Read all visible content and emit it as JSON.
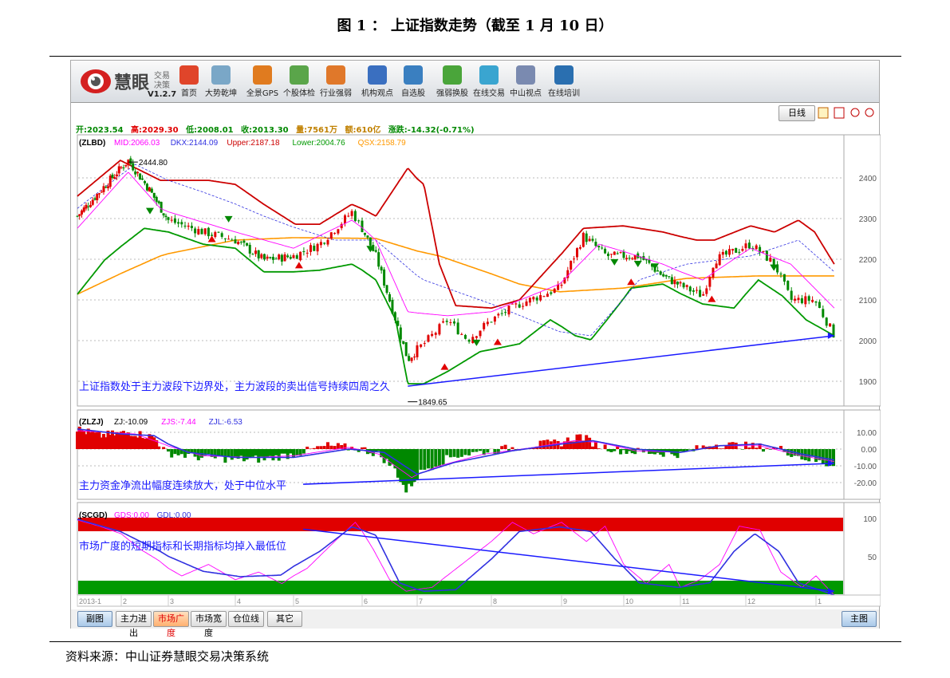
{
  "title": "图 1 ： 上证指数走势（截至 1 月 10 日）",
  "source": "资料来源：中山证券慧眼交易决策系统",
  "app": {
    "logo_name": "慧眼",
    "logo_sub1": "交易",
    "logo_sub2": "决策",
    "version": "V1.2.7",
    "toolbar": [
      {
        "label": "首页",
        "icon": "home-icon",
        "color": "#e0452a"
      },
      {
        "label": "大势乾坤",
        "icon": "magnifier-doc-icon",
        "color": "#7aa7c7"
      },
      {
        "label": "全景GPS",
        "icon": "grid-icon",
        "color": "#e07b1f"
      },
      {
        "label": "个股体检",
        "icon": "checkup-icon",
        "color": "#5aa54a"
      },
      {
        "label": "行业强弱",
        "icon": "bar-chart-icon",
        "color": "#e0782a"
      },
      {
        "label": "机构观点",
        "icon": "person-icon",
        "color": "#3a6fc0"
      },
      {
        "label": "自选股",
        "icon": "briefcase-icon",
        "color": "#3a7fc0"
      },
      {
        "label": "强弱换股",
        "icon": "refresh-icon",
        "color": "#4aa53a"
      },
      {
        "label": "在线交易",
        "icon": "cart-icon",
        "color": "#3aa5d0"
      },
      {
        "label": "中山视点",
        "icon": "document-icon",
        "color": "#7a8ab0"
      },
      {
        "label": "在线培训",
        "icon": "monitor-icon",
        "color": "#2a6fb0"
      }
    ],
    "period_button": "日线",
    "info": {
      "open": "开:2023.54",
      "high": "高:2029.30",
      "low": "低:2008.01",
      "close": "收:2013.30",
      "volume": "量:7561万",
      "amount": "额:610亿",
      "change": "涨跌:-14.32(-0.71%)"
    },
    "bottom_buttons": [
      "副图",
      "主力进出",
      "市场广度",
      "市场宽度",
      "仓位线",
      "其它"
    ],
    "active_bottom": "市场广度",
    "main_button": "主图"
  },
  "colors": {
    "up": "#e00000",
    "down": "#008800",
    "mid": "#ff00ff",
    "dkx": "#3030e0",
    "upper": "#cc0000",
    "lower": "#009900",
    "qsx": "#ff9900",
    "annotation": "#1a1aff"
  },
  "chart_data": [
    {
      "type": "candlestick",
      "name_label": "(ZLBD)",
      "legend": [
        {
          "label": "MID:2066.03",
          "key": "mid"
        },
        {
          "label": "DKX:2144.09",
          "key": "dkx"
        },
        {
          "label": "Upper:2187.18",
          "key": "upper"
        },
        {
          "label": "Lower:2004.76",
          "key": "lower"
        },
        {
          "label": "QSX:2158.79",
          "key": "qsx"
        }
      ],
      "ylim": [
        1850,
        2500
      ],
      "yticks": [
        "2400",
        "2300",
        "2200",
        "2100",
        "2000",
        "1900"
      ],
      "ytick_values": [
        2400,
        2300,
        2200,
        2100,
        2000,
        1900
      ],
      "x_unit": "month (1 = 2013-1, 13 = 2014-1)",
      "close": [
        [
          1.0,
          2306
        ],
        [
          2.15,
          2443
        ],
        [
          2.58,
          2374
        ],
        [
          3.0,
          2296
        ],
        [
          3.52,
          2267
        ],
        [
          4.0,
          2247
        ],
        [
          4.49,
          2198
        ],
        [
          5.0,
          2208
        ],
        [
          5.38,
          2237
        ],
        [
          5.85,
          2316
        ],
        [
          6.25,
          2208
        ],
        [
          6.61,
          2051
        ],
        [
          6.83,
          1953
        ],
        [
          7.09,
          1992
        ],
        [
          7.41,
          2051
        ],
        [
          7.68,
          2002
        ],
        [
          8.0,
          2051
        ],
        [
          8.4,
          2090
        ],
        [
          8.97,
          2129
        ],
        [
          9.35,
          2257
        ],
        [
          9.73,
          2208
        ],
        [
          10.27,
          2208
        ],
        [
          10.69,
          2159
        ],
        [
          11.34,
          2110
        ],
        [
          11.52,
          2198
        ],
        [
          12.07,
          2237
        ],
        [
          12.41,
          2188
        ],
        [
          12.64,
          2100
        ],
        [
          12.98,
          2100
        ],
        [
          13.26,
          2013
        ]
      ],
      "upper": [
        [
          1.0,
          2355
        ],
        [
          1.98,
          2443
        ],
        [
          2.83,
          2394
        ],
        [
          3.6,
          2394
        ],
        [
          4.0,
          2384
        ],
        [
          4.49,
          2335
        ],
        [
          5.03,
          2286
        ],
        [
          5.38,
          2286
        ],
        [
          5.85,
          2335
        ],
        [
          6.25,
          2306
        ],
        [
          6.83,
          2424
        ],
        [
          7.09,
          2384
        ],
        [
          7.3,
          2188
        ],
        [
          7.52,
          2086
        ],
        [
          8.0,
          2080
        ],
        [
          8.4,
          2100
        ],
        [
          8.97,
          2208
        ],
        [
          9.35,
          2276
        ],
        [
          9.99,
          2282
        ],
        [
          10.69,
          2267
        ],
        [
          11.25,
          2247
        ],
        [
          11.52,
          2247
        ],
        [
          12.07,
          2282
        ],
        [
          12.41,
          2267
        ],
        [
          12.75,
          2296
        ],
        [
          12.98,
          2267
        ],
        [
          13.26,
          2188
        ]
      ],
      "lower": [
        [
          1.0,
          2114
        ],
        [
          1.62,
          2198
        ],
        [
          2.49,
          2276
        ],
        [
          3.0,
          2267
        ],
        [
          3.52,
          2237
        ],
        [
          4.0,
          2227
        ],
        [
          4.49,
          2169
        ],
        [
          5.0,
          2169
        ],
        [
          5.38,
          2173
        ],
        [
          5.85,
          2188
        ],
        [
          6.25,
          2149
        ],
        [
          6.61,
          2051
        ],
        [
          6.83,
          1894
        ],
        [
          7.09,
          1894
        ],
        [
          7.41,
          1924
        ],
        [
          7.85,
          1973
        ],
        [
          8.4,
          1992
        ],
        [
          8.84,
          2051
        ],
        [
          9.22,
          2012
        ],
        [
          9.47,
          2002
        ],
        [
          9.73,
          2051
        ],
        [
          10.13,
          2129
        ],
        [
          10.69,
          2139
        ],
        [
          11.34,
          2090
        ],
        [
          11.82,
          2080
        ],
        [
          12.18,
          2149
        ],
        [
          12.52,
          2110
        ],
        [
          12.86,
          2051
        ],
        [
          13.26,
          2012
        ]
      ],
      "qsx": [
        [
          1.0,
          2114
        ],
        [
          2.83,
          2208
        ],
        [
          4.0,
          2247
        ],
        [
          5.0,
          2253
        ],
        [
          6.25,
          2251
        ],
        [
          7.3,
          2208
        ],
        [
          8.4,
          2139
        ],
        [
          8.97,
          2120
        ],
        [
          9.99,
          2129
        ],
        [
          11.1,
          2153
        ],
        [
          12.18,
          2159
        ],
        [
          13.26,
          2159
        ]
      ],
      "mid": [
        [
          1.0,
          2276
        ],
        [
          2.15,
          2414
        ],
        [
          2.83,
          2325
        ],
        [
          4.0,
          2267
        ],
        [
          5.0,
          2227
        ],
        [
          5.85,
          2296
        ],
        [
          6.25,
          2247
        ],
        [
          6.83,
          2071
        ],
        [
          7.41,
          2061
        ],
        [
          8.0,
          2071
        ],
        [
          8.97,
          2139
        ],
        [
          9.6,
          2237
        ],
        [
          10.69,
          2188
        ],
        [
          11.34,
          2149
        ],
        [
          12.07,
          2227
        ],
        [
          12.64,
          2188
        ],
        [
          13.26,
          2080
        ]
      ],
      "dkx": [
        [
          1.0,
          2325
        ],
        [
          2.3,
          2433
        ],
        [
          3.52,
          2365
        ],
        [
          4.49,
          2306
        ],
        [
          5.6,
          2247
        ],
        [
          6.25,
          2247
        ],
        [
          7.09,
          2149
        ],
        [
          8.0,
          2090
        ],
        [
          8.97,
          2022
        ],
        [
          9.47,
          2012
        ],
        [
          10.27,
          2149
        ],
        [
          11.1,
          2188
        ],
        [
          12.07,
          2208
        ],
        [
          12.75,
          2247
        ],
        [
          13.26,
          2169
        ]
      ],
      "sell_signals": [
        2.61,
        3.9,
        6.15,
        7.8,
        9.85,
        10.25,
        10.55,
        12.4
      ],
      "buy_signals": [
        3.65,
        5.08,
        7.37,
        8.09,
        10.13,
        11.48
      ],
      "annotations": [
        {
          "text": "2444.80",
          "x": 2.15,
          "y": 2444.8
        },
        {
          "text": "1849.65",
          "x": 6.83,
          "y": 1849.65
        }
      ],
      "trendline": [
        [
          6.83,
          1888
        ],
        [
          13.26,
          2012
        ]
      ],
      "comment": "上证指数处于主力波段下边界处，主力波段的卖出信号持续四周之久"
    },
    {
      "type": "bar",
      "name_label": "(ZLZJ)",
      "legend": [
        {
          "label": "ZJ:-10.09",
          "key": "zj"
        },
        {
          "label": "ZJS:-7.44",
          "key": "zjs"
        },
        {
          "label": "ZJL:-6.53",
          "key": "zjl"
        }
      ],
      "ylim": [
        -30,
        14
      ],
      "yticks": [
        "10.00",
        "0.00",
        "-10.00",
        "-20.00"
      ],
      "ytick_values": [
        10,
        0,
        -10,
        -20
      ],
      "zj": [
        [
          1.0,
          12
        ],
        [
          1.5,
          8
        ],
        [
          2.2,
          10
        ],
        [
          2.7,
          7
        ],
        [
          2.95,
          -2
        ],
        [
          3.5,
          -5
        ],
        [
          4.0,
          -6
        ],
        [
          4.5,
          -6
        ],
        [
          5.0,
          -3
        ],
        [
          5.5,
          2
        ],
        [
          6.0,
          0
        ],
        [
          6.3,
          -3
        ],
        [
          6.6,
          -12
        ],
        [
          6.8,
          -25
        ],
        [
          7.1,
          -12
        ],
        [
          7.5,
          -4
        ],
        [
          8.0,
          -1
        ],
        [
          8.5,
          2
        ],
        [
          9.0,
          4
        ],
        [
          9.3,
          8
        ],
        [
          9.6,
          2
        ],
        [
          10.0,
          -1
        ],
        [
          10.5,
          -2
        ],
        [
          11.0,
          -3
        ],
        [
          11.5,
          3
        ],
        [
          12.0,
          2
        ],
        [
          12.5,
          0
        ],
        [
          12.8,
          -5
        ],
        [
          13.26,
          -10.09
        ]
      ],
      "zjs": [
        [
          1.0,
          11
        ],
        [
          2.3,
          9
        ],
        [
          2.9,
          3
        ],
        [
          3.5,
          -4
        ],
        [
          4.3,
          -5
        ],
        [
          5.0,
          -4
        ],
        [
          5.8,
          1
        ],
        [
          6.3,
          -3
        ],
        [
          6.9,
          -17
        ],
        [
          7.3,
          -10
        ],
        [
          7.9,
          -3
        ],
        [
          8.6,
          1
        ],
        [
          9.2,
          5
        ],
        [
          9.6,
          4
        ],
        [
          10.2,
          -1
        ],
        [
          11.0,
          -2
        ],
        [
          11.6,
          2
        ],
        [
          12.2,
          2
        ],
        [
          12.8,
          -4
        ],
        [
          13.26,
          -7.44
        ]
      ],
      "zjl": [
        [
          1.0,
          12
        ],
        [
          2.0,
          9
        ],
        [
          2.7,
          8
        ],
        [
          3.3,
          -2
        ],
        [
          4.0,
          -5
        ],
        [
          5.0,
          -5
        ],
        [
          5.8,
          0
        ],
        [
          6.4,
          -2
        ],
        [
          7.0,
          -15
        ],
        [
          7.5,
          -8
        ],
        [
          8.3,
          -1
        ],
        [
          9.0,
          3
        ],
        [
          9.5,
          5
        ],
        [
          10.2,
          0
        ],
        [
          11.0,
          -2
        ],
        [
          11.6,
          2
        ],
        [
          12.2,
          3
        ],
        [
          12.8,
          -3
        ],
        [
          13.26,
          -6.53
        ]
      ],
      "trendline": [
        [
          5.14,
          -21
        ],
        [
          13.26,
          -8.5
        ]
      ],
      "comment": "主力资金净流出幅度连续放大，处于中位水平"
    },
    {
      "type": "line",
      "name_label": "(SCGD)",
      "legend": [
        {
          "label": "GDS:0.00",
          "key": "gds"
        },
        {
          "label": "GDL:0.00",
          "key": "gdl"
        }
      ],
      "ylim": [
        0,
        100
      ],
      "yticks": [
        "100",
        "50"
      ],
      "ytick_values": [
        100,
        50
      ],
      "gdl": [
        [
          1.0,
          99
        ],
        [
          1.98,
          83
        ],
        [
          2.83,
          57
        ],
        [
          3.52,
          31
        ],
        [
          4.08,
          24
        ],
        [
          4.78,
          26
        ],
        [
          5.38,
          57
        ],
        [
          5.85,
          89
        ],
        [
          6.25,
          78
        ],
        [
          6.68,
          16
        ],
        [
          7.09,
          5
        ],
        [
          7.52,
          7
        ],
        [
          8.0,
          47
        ],
        [
          8.4,
          83
        ],
        [
          8.97,
          89
        ],
        [
          9.47,
          83
        ],
        [
          9.86,
          47
        ],
        [
          10.27,
          16
        ],
        [
          10.97,
          10
        ],
        [
          11.45,
          16
        ],
        [
          11.82,
          57
        ],
        [
          12.13,
          80
        ],
        [
          12.47,
          57
        ],
        [
          12.75,
          16
        ],
        [
          13.26,
          0
        ]
      ],
      "gds": [
        [
          1.0,
          98
        ],
        [
          1.5,
          90
        ],
        [
          2.0,
          80
        ],
        [
          2.4,
          60
        ],
        [
          2.8,
          45
        ],
        [
          3.2,
          25
        ],
        [
          3.6,
          40
        ],
        [
          4.0,
          20
        ],
        [
          4.4,
          30
        ],
        [
          4.8,
          15
        ],
        [
          5.2,
          35
        ],
        [
          5.6,
          70
        ],
        [
          5.9,
          95
        ],
        [
          6.2,
          60
        ],
        [
          6.5,
          20
        ],
        [
          6.8,
          5
        ],
        [
          7.2,
          10
        ],
        [
          7.6,
          40
        ],
        [
          8.0,
          70
        ],
        [
          8.3,
          95
        ],
        [
          8.6,
          80
        ],
        [
          9.0,
          95
        ],
        [
          9.4,
          70
        ],
        [
          9.7,
          90
        ],
        [
          10.0,
          40
        ],
        [
          10.4,
          15
        ],
        [
          10.8,
          40
        ],
        [
          11.0,
          10
        ],
        [
          11.3,
          20
        ],
        [
          11.6,
          40
        ],
        [
          11.9,
          90
        ],
        [
          12.2,
          85
        ],
        [
          12.5,
          30
        ],
        [
          12.8,
          10
        ],
        [
          13.0,
          25
        ],
        [
          13.26,
          0
        ]
      ],
      "trendline": [
        [
          5.14,
          86
        ],
        [
          13.26,
          5
        ]
      ],
      "comment": "市场广度的短期指标和长期指标均掉入最低位"
    }
  ],
  "x_axis": {
    "labels": [
      "2013-1",
      "2",
      "3",
      "4",
      "5",
      "6",
      "7",
      "8",
      "9",
      "10",
      "11",
      "12",
      "1"
    ]
  }
}
